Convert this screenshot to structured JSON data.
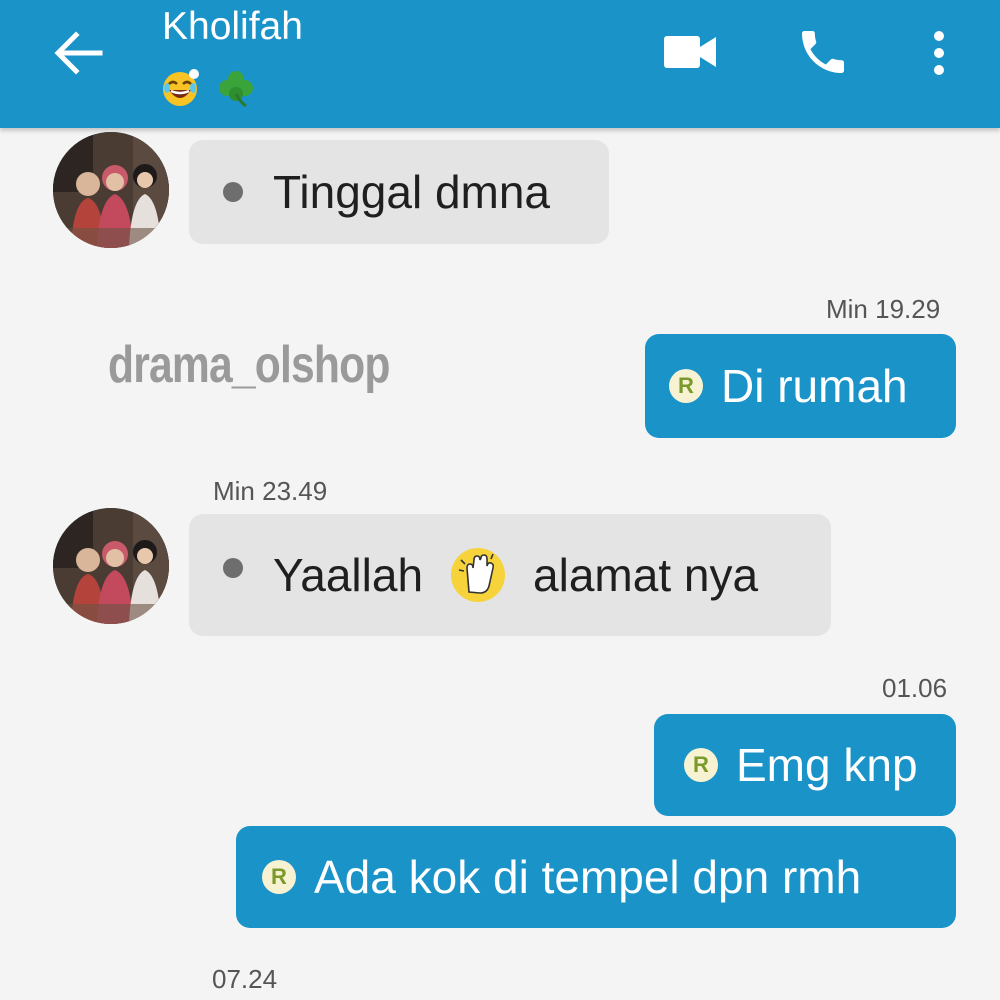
{
  "header": {
    "contact_name": "Kholifah",
    "status_emojis": [
      "laughing-emoji",
      "clover-emoji"
    ],
    "icons": [
      "back-arrow-icon",
      "video-call-icon",
      "phone-icon",
      "more-vert-icon"
    ]
  },
  "watermark": "drama_olshop",
  "messages": [
    {
      "direction": "incoming",
      "text": "Tinggal dmna",
      "timestamp": ""
    },
    {
      "direction": "outgoing",
      "text": "Di rumah",
      "timestamp": "Min 19.29",
      "badge": "R"
    },
    {
      "direction": "incoming",
      "text_before": "Yaallah",
      "emoji": "high-five-emoji",
      "text_after": "alamat nya",
      "timestamp": "Min 23.49"
    },
    {
      "direction": "outgoing",
      "text": "Emg knp",
      "timestamp": "01.06",
      "badge": "R"
    },
    {
      "direction": "outgoing",
      "text": "Ada kok di tempel dpn rmh",
      "timestamp": "",
      "badge": "R"
    }
  ],
  "trailing_timestamp": "07.24",
  "colors": {
    "header": "#1a93c8",
    "outgoing_bubble": "#1a93c8",
    "incoming_bubble": "#e4e4e4",
    "background": "#f4f4f4"
  }
}
